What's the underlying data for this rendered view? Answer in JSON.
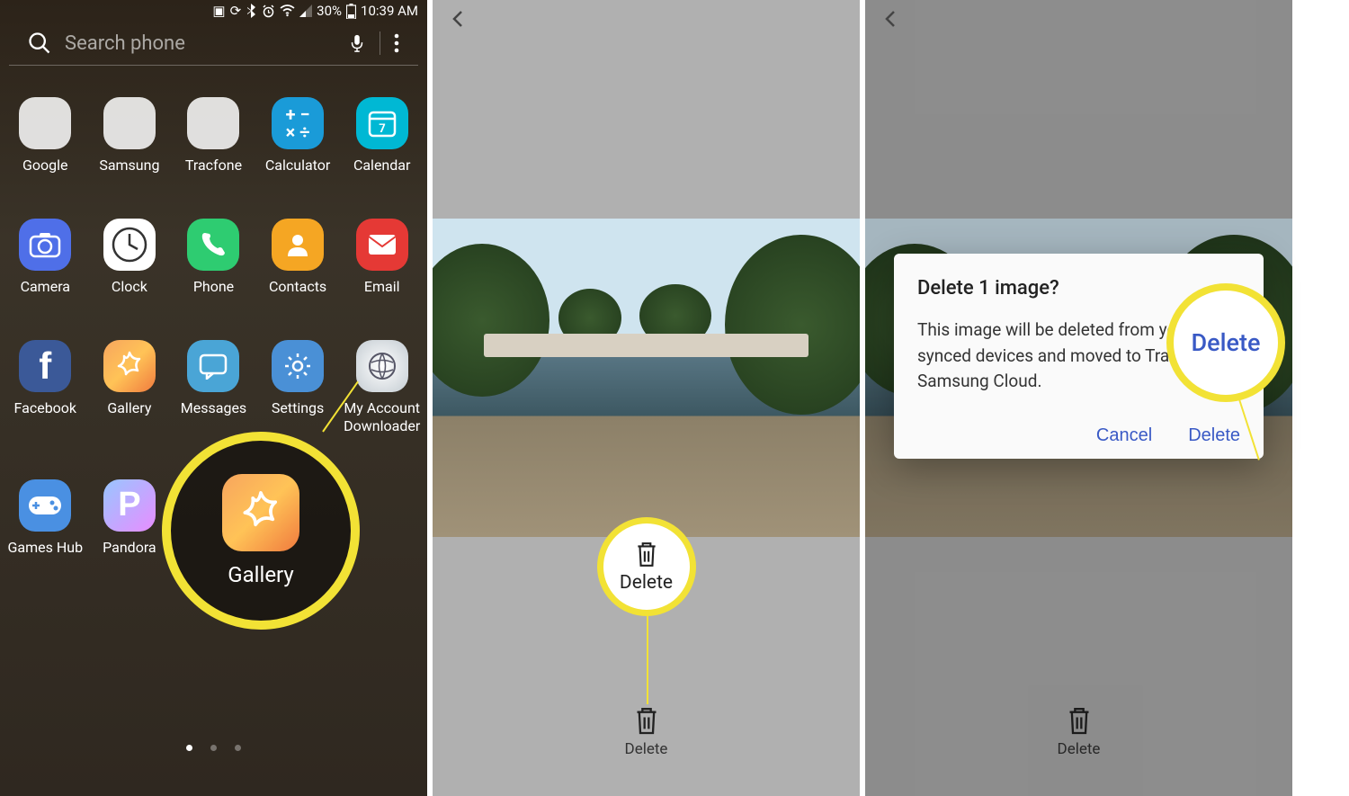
{
  "status": {
    "battery_pct": "30%",
    "time": "10:39 AM"
  },
  "search": {
    "placeholder": "Search phone"
  },
  "apps": {
    "row1": [
      {
        "label": "Google"
      },
      {
        "label": "Samsung"
      },
      {
        "label": "Tracfone"
      },
      {
        "label": "Calculator"
      },
      {
        "label": "Calendar",
        "badge": "7"
      }
    ],
    "row2": [
      {
        "label": "Camera"
      },
      {
        "label": "Clock"
      },
      {
        "label": "Phone"
      },
      {
        "label": "Contacts"
      },
      {
        "label": "Email"
      }
    ],
    "row3": [
      {
        "label": "Facebook"
      },
      {
        "label": "Gallery"
      },
      {
        "label": "Messages"
      },
      {
        "label": "Settings"
      },
      {
        "label": "My Account Downloader"
      }
    ],
    "row4": [
      {
        "label": "Games Hub"
      },
      {
        "label": "Pandora"
      }
    ]
  },
  "callout": {
    "gallery": "Gallery",
    "delete": "Delete",
    "dialog_delete": "Delete"
  },
  "panel2": {
    "action": "Delete"
  },
  "panel3": {
    "action": "Delete",
    "dialog": {
      "title": "Delete 1 image?",
      "body": "This image will be deleted from your synced devices and moved to Trash in Samsung Cloud.",
      "cancel": "Cancel",
      "confirm": "Delete"
    }
  }
}
